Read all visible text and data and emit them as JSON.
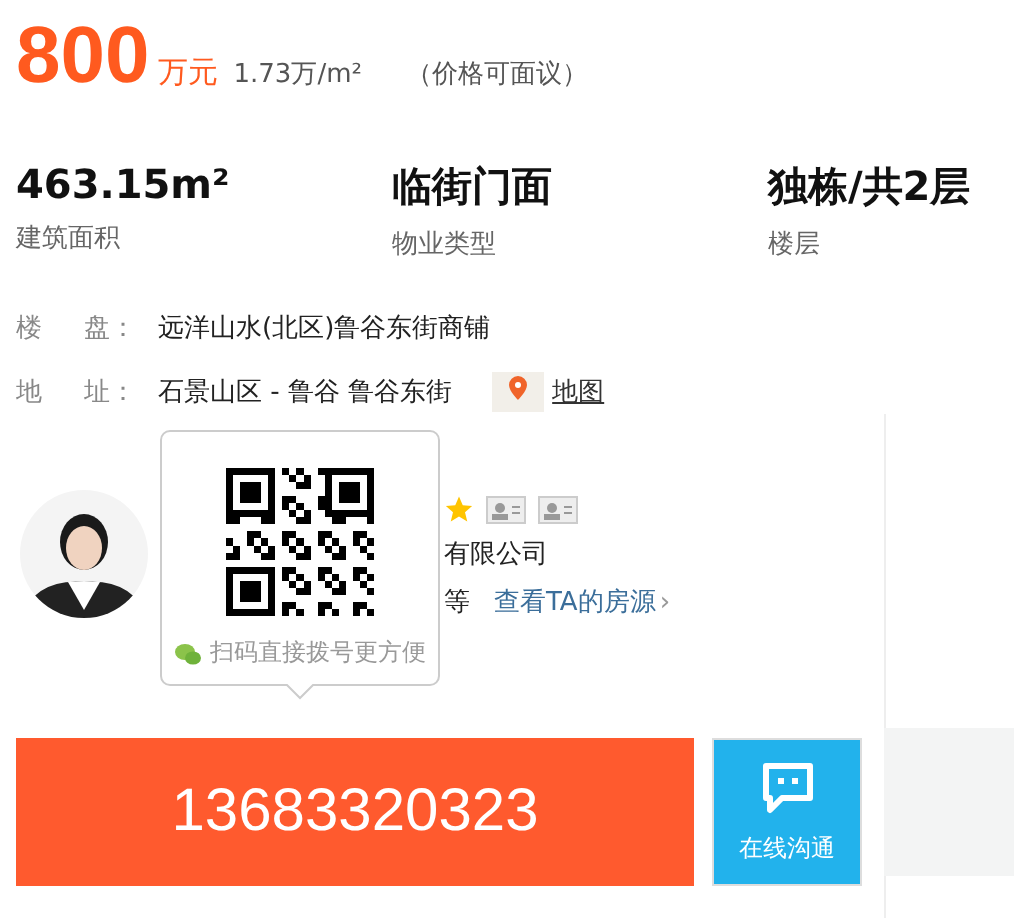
{
  "price": {
    "amount": "800",
    "unit": "万元",
    "unit_price": "1.73万/m²",
    "note": "（价格可面议）"
  },
  "stats": [
    {
      "value": "463.15m²",
      "label": "建筑面积"
    },
    {
      "value": "临街门面",
      "label": "物业类型"
    },
    {
      "value": "独栋/共2层",
      "label": "楼层"
    }
  ],
  "details": [
    {
      "label_1": "楼",
      "label_2": "盘：",
      "value": "远洋山水(北区)鲁谷东街商铺"
    },
    {
      "label_1": "地",
      "label_2": "址：",
      "value": "石景山区 - 鲁谷 鲁谷东街",
      "link": "地图"
    }
  ],
  "agent": {
    "company": "有限公司",
    "level_suffix": "等",
    "listings_link": "查看TA的房源",
    "chevron": "›"
  },
  "qr_popup": {
    "caption": "扫码直接拨号更方便"
  },
  "phone_button": "13683320323",
  "chat_button": "在线沟通"
}
